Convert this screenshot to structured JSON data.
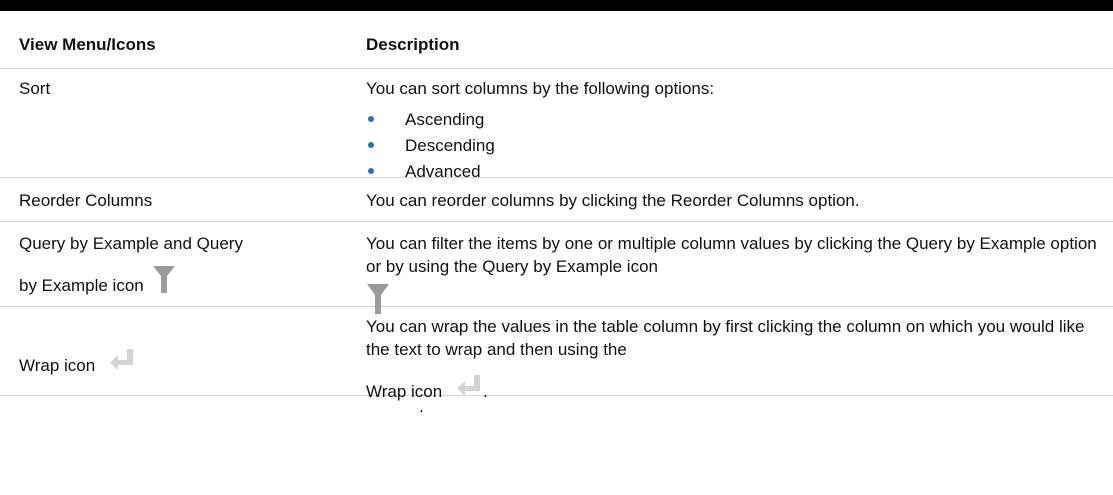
{
  "header": {
    "col1": "View Menu/Icons",
    "col2": "Description"
  },
  "rows": {
    "sort": {
      "name": "Sort",
      "desc": "You can sort columns by the following options:",
      "options": [
        "Ascending",
        "Descending",
        "Advanced"
      ]
    },
    "reorder": {
      "name": "Reorder Columns",
      "desc": "You can reorder columns by clicking the Reorder Columns option."
    },
    "query": {
      "name_line1": "Query by Example and Query",
      "name_line2": "by Example icon",
      "desc": "You can filter the items by one or multiple column values by clicking the Query by Example option or by using the Query by Example icon",
      "desc_end": "."
    },
    "wrap": {
      "name": "Wrap icon",
      "desc": "You can wrap the values in the table column by first clicking the column on which you would like the text to wrap and then using the",
      "desc_icon_label": "Wrap icon",
      "desc_end": "."
    }
  },
  "icons": {
    "query": "funnel-icon",
    "wrap": "wrap-arrow-icon"
  },
  "colors": {
    "rule": "#000000",
    "bullet": "#2f6fb9",
    "icon_gray": "#9a9a9a"
  }
}
